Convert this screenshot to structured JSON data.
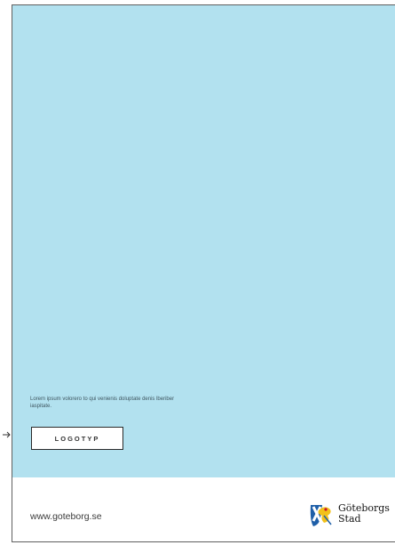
{
  "body_text": "Lorem ipsum volorero to qui venienis doluptate denis lberiber iaspitate.",
  "logo_placeholder": "LOGOTYP",
  "footer": {
    "url": "www.goteborg.se",
    "brand_line1": "Göteborgs",
    "brand_line2": "Stad"
  },
  "colors": {
    "panel": "#b2e1ef",
    "page": "#ffffff",
    "text": "#3a3a3a"
  },
  "icons": [
    "goteborg-coat-of-arms-icon",
    "arrow-right-icon"
  ]
}
